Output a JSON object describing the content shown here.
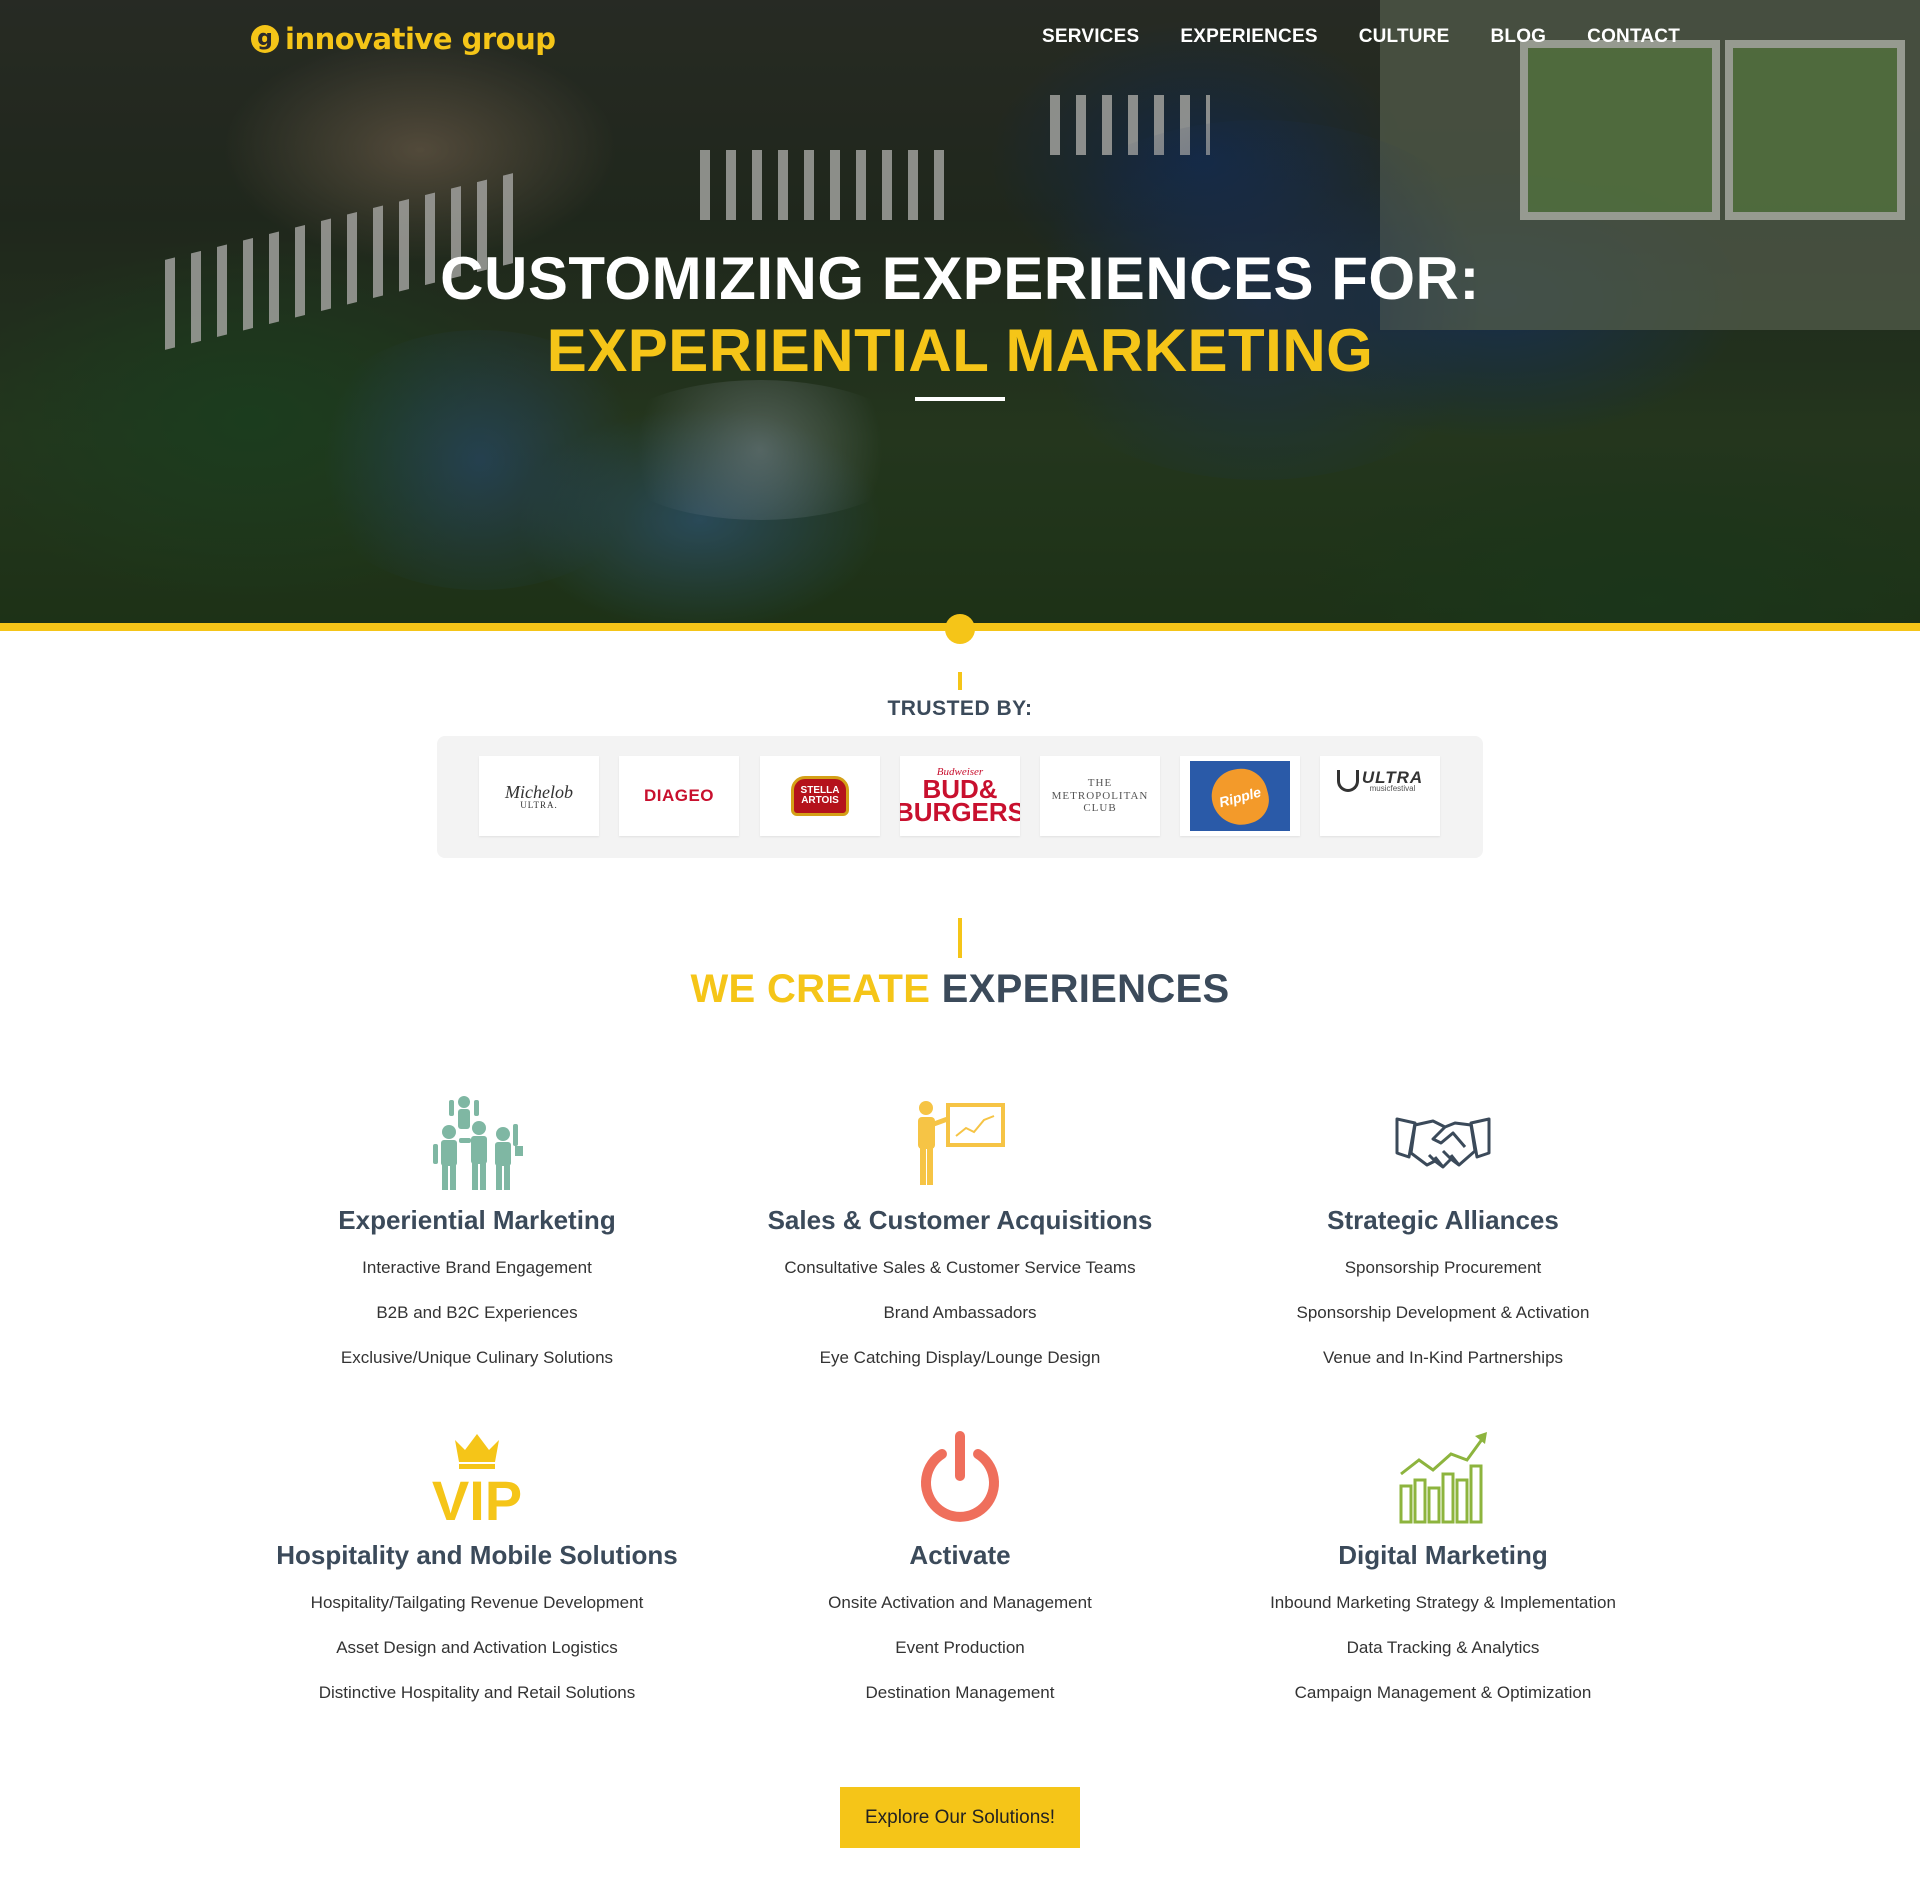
{
  "header": {
    "logo_mark": "g",
    "logo_text": "innovative group",
    "nav": [
      "SERVICES",
      "EXPERIENCES",
      "CULTURE",
      "BLOG",
      "CONTACT"
    ]
  },
  "hero": {
    "line1": "CUSTOMIZING EXPERIENCES FOR:",
    "line2": "EXPERIENTIAL MARKETING"
  },
  "trusted": {
    "label": "TRUSTED BY:",
    "brands": {
      "michelob": {
        "main": "Michelob",
        "sub": "ULTRA."
      },
      "diageo": "DIAGEO",
      "stella": {
        "line1": "STELLA",
        "line2": "ARTOIS"
      },
      "bud": {
        "top": "Budweiser",
        "main1": "BUD&",
        "main2": "BURGERS"
      },
      "metropolitan": {
        "line1": "THE",
        "line2": "METROPOLITAN",
        "line3": "CLUB"
      },
      "ripple": "Ripple",
      "ultra": {
        "main": "ULTRA",
        "sub": "musicfestival"
      }
    }
  },
  "experiences": {
    "title_a": "WE CREATE",
    "title_b": "EXPERIENCES",
    "cards": [
      {
        "icon": "crowd-people-icon",
        "title": "Experiential Marketing",
        "items": [
          "Interactive Brand Engagement",
          "B2B and B2C Experiences",
          "Exclusive/Unique Culinary Solutions"
        ],
        "color": "#7fb7a3"
      },
      {
        "icon": "presentation-icon",
        "title": "Sales & Customer Acquisitions",
        "items": [
          "Consultative Sales & Customer Service Teams",
          "Brand Ambassadors",
          "Eye Catching Display/Lounge Design"
        ],
        "color": "#f6c445"
      },
      {
        "icon": "handshake-icon",
        "title": "Strategic Alliances",
        "items": [
          "Sponsorship Procurement",
          "Sponsorship Development & Activation",
          "Venue and In-Kind Partnerships"
        ],
        "color": "#3b4a5a"
      },
      {
        "icon": "vip-crown-icon",
        "title": "Hospitality and Mobile Solutions",
        "items": [
          "Hospitality/Tailgating Revenue Development",
          "Asset Design and Activation Logistics",
          "Distinctive Hospitality and Retail Solutions"
        ],
        "color": "#f5c518"
      },
      {
        "icon": "power-icon",
        "title": "Activate",
        "items": [
          "Onsite Activation and Management",
          "Event Production",
          "Destination Management"
        ],
        "color": "#ef6f5c"
      },
      {
        "icon": "growth-chart-icon",
        "title": "Digital Marketing",
        "items": [
          "Inbound Marketing Strategy & Implementation",
          "Data Tracking & Analytics",
          "Campaign Management & Optimization"
        ],
        "color": "#8db43e"
      }
    ],
    "vip_text": "VIP"
  },
  "cta": {
    "label": "Explore Our Solutions!"
  },
  "colors": {
    "accent": "#f5c518",
    "heading": "#3b4a5a"
  }
}
